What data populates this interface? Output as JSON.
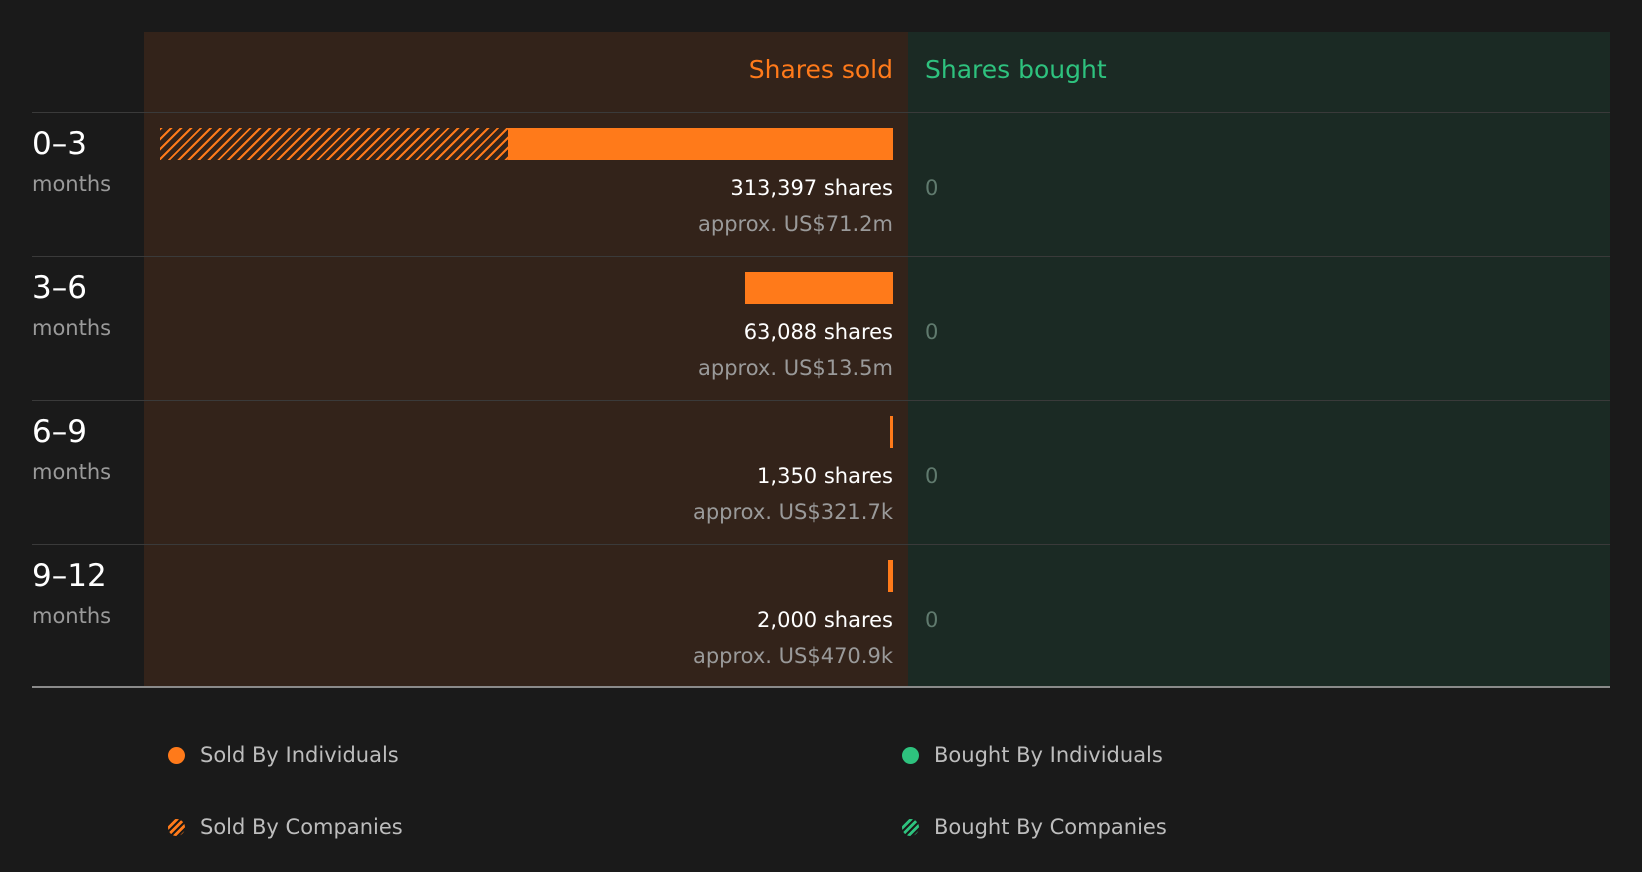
{
  "chart_data": {
    "type": "bar",
    "headers": {
      "sold": "Shares sold",
      "bought": "Shares bought"
    },
    "categories": [
      {
        "label": "0–3",
        "sublabel": "months"
      },
      {
        "label": "3–6",
        "sublabel": "months"
      },
      {
        "label": "6–9",
        "sublabel": "months"
      },
      {
        "label": "9–12",
        "sublabel": "months"
      }
    ],
    "series": [
      {
        "name": "Sold By Individuals",
        "values": [
          164800,
          63088,
          1350,
          2000
        ]
      },
      {
        "name": "Sold By Companies",
        "values": [
          148597,
          0,
          0,
          0
        ]
      },
      {
        "name": "Bought By Individuals",
        "values": [
          0,
          0,
          0,
          0
        ]
      },
      {
        "name": "Bought By Companies",
        "values": [
          0,
          0,
          0,
          0
        ]
      }
    ],
    "sold_totals": [
      "313,397 shares",
      "63,088 shares",
      "1,350 shares",
      "2,000 shares"
    ],
    "sold_values": [
      "approx. US$71.2m",
      "approx. US$13.5m",
      "approx. US$321.7k",
      "approx. US$470.9k"
    ],
    "bought_totals": [
      "0",
      "0",
      "0",
      "0"
    ],
    "xlim": [
      0,
      313397
    ],
    "legend": [
      {
        "label": "Sold By Individuals",
        "style": "solid",
        "color": "#ff7a1a"
      },
      {
        "label": "Bought By Individuals",
        "style": "solid",
        "color": "#2ec27e"
      },
      {
        "label": "Sold By Companies",
        "style": "hatched",
        "color": "#ff7a1a"
      },
      {
        "label": "Bought By Companies",
        "style": "hatched",
        "color": "#2ec27e"
      }
    ],
    "colors": {
      "sold": "#ff7a1a",
      "bought": "#2ec27e"
    }
  }
}
